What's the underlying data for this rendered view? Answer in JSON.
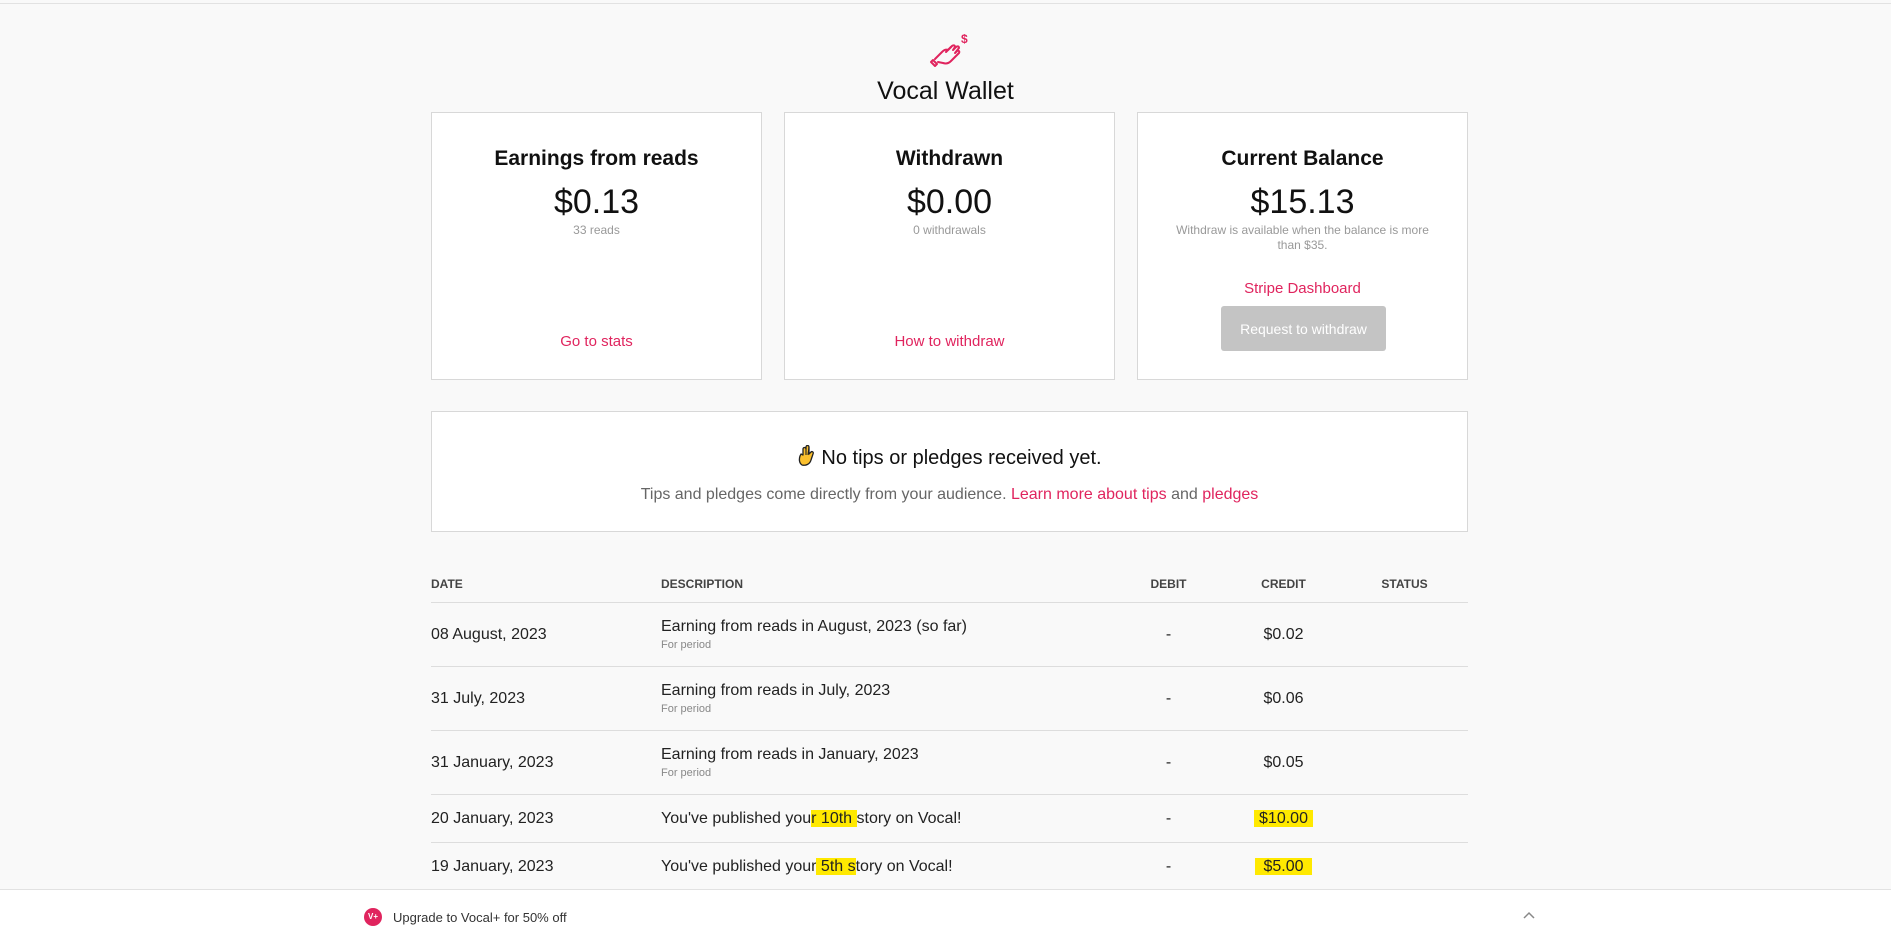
{
  "header": {
    "icon": "hand-coin-icon",
    "title": "Vocal Wallet"
  },
  "cards": {
    "earnings": {
      "title": "Earnings from reads",
      "amount": "$0.13",
      "sub": "33 reads",
      "link": "Go to stats"
    },
    "withdrawn": {
      "title": "Withdrawn",
      "amount": "$0.00",
      "sub": "0 withdrawals",
      "link": "How to withdraw"
    },
    "balance": {
      "title": "Current Balance",
      "amount": "$15.13",
      "sub": "Withdraw is available when the balance is more than $35.",
      "link": "Stripe Dashboard",
      "button": "Request to withdraw"
    }
  },
  "tips": {
    "icon": "crossed-fingers-icon",
    "headline": "No tips or pledges received yet.",
    "desc_prefix": "Tips and pledges come directly from your audience.",
    "link_tips": "Learn more about tips",
    "and": "and",
    "link_pledges": "pledges"
  },
  "table": {
    "headers": {
      "date": "DATE",
      "description": "DESCRIPTION",
      "debit": "DEBIT",
      "credit": "CREDIT",
      "status": "STATUS"
    },
    "rows": [
      {
        "date": "08 August, 2023",
        "description": "Earning from reads in August, 2023 (so far)",
        "note": "For period",
        "debit": "-",
        "credit": "$0.02"
      },
      {
        "date": "31 July, 2023",
        "description": "Earning from reads in July, 2023",
        "note": "For period",
        "debit": "-",
        "credit": "$0.06"
      },
      {
        "date": "31 January, 2023",
        "description": "Earning from reads in January, 2023",
        "note": "For period",
        "debit": "-",
        "credit": "$0.05"
      },
      {
        "date": "20 January, 2023",
        "desc_a": "You've published you",
        "desc_hl": "r 10th ",
        "desc_b": "story on Vocal!",
        "debit": "-",
        "credit": "$10.00"
      },
      {
        "date": "19 January, 2023",
        "desc_a": "You've published your",
        "desc_hl": " 5th s",
        "desc_b": "tory on Vocal!",
        "debit": "-",
        "credit": "$5.00"
      }
    ]
  },
  "bottom_bar": {
    "badge": "V+",
    "text": "Upgrade to Vocal+ for 50% off",
    "chevron": "chevron-up-icon"
  },
  "colors": {
    "accent": "#e0245e",
    "highlight": "#ffe900",
    "button_disabled": "#c4c4c4"
  }
}
